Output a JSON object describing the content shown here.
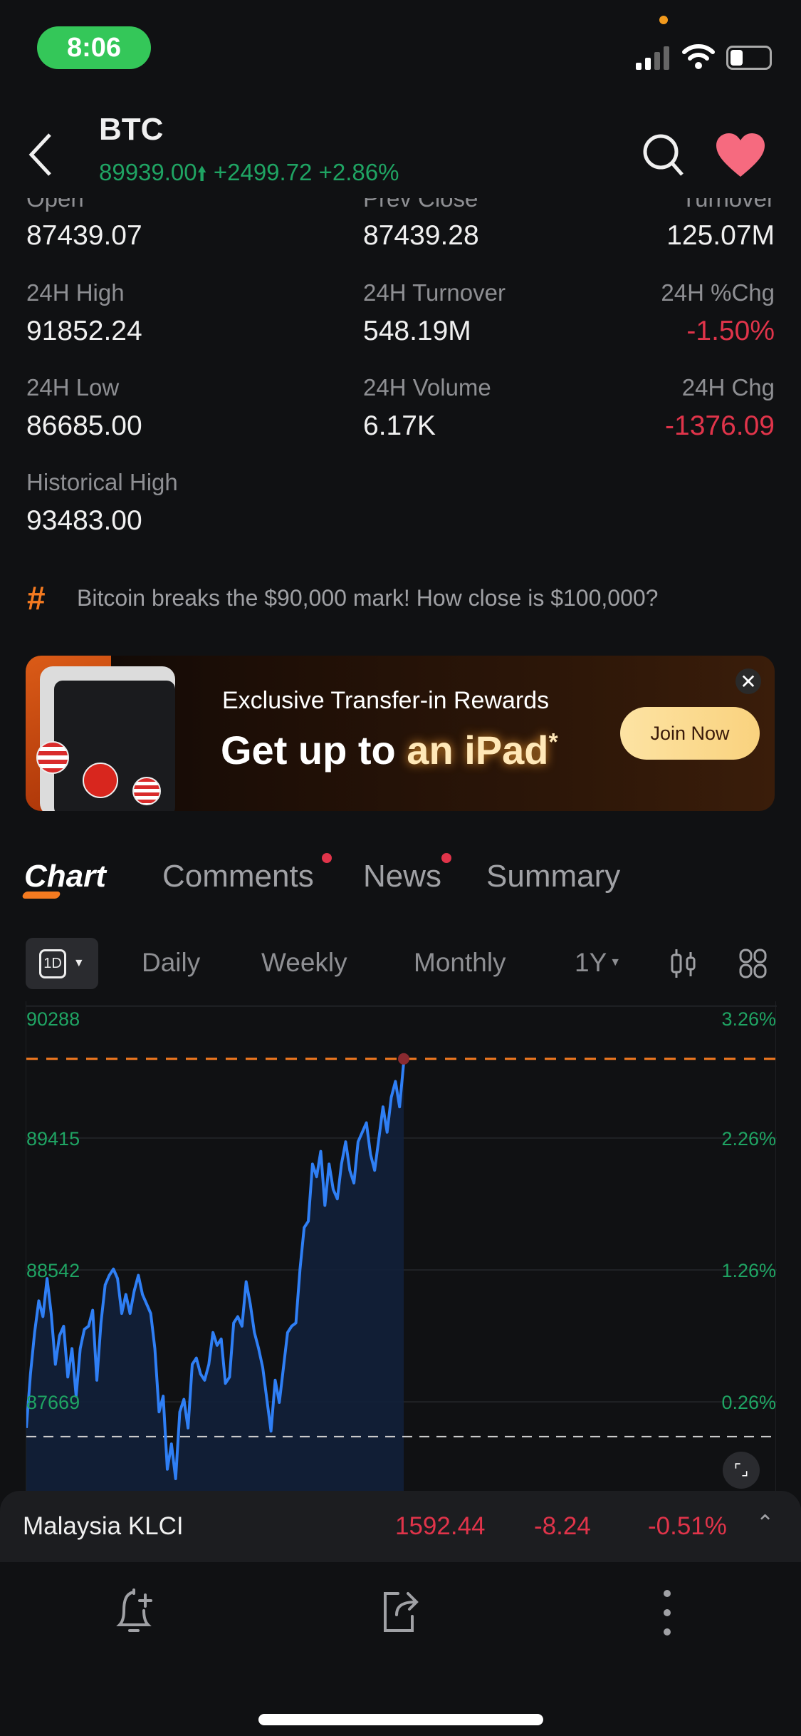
{
  "status_bar": {
    "time": "8:06"
  },
  "header": {
    "symbol": "BTC",
    "price": "89939.00",
    "change": "+2499.72",
    "change_pct": "+2.86%"
  },
  "stats": {
    "rows": [
      [
        {
          "label": "Open",
          "value": "87439.07"
        },
        {
          "label": "Prev Close",
          "value": "87439.28"
        },
        {
          "label": "Turnover",
          "value": "125.07M"
        }
      ],
      [
        {
          "label": "24H High",
          "value": "91852.24"
        },
        {
          "label": "24H Turnover",
          "value": "548.19M"
        },
        {
          "label": "24H %Chg",
          "value": "-1.50%",
          "color": "#e0344a"
        }
      ],
      [
        {
          "label": "24H Low",
          "value": "86685.00"
        },
        {
          "label": "24H Volume",
          "value": "6.17K"
        },
        {
          "label": "24H Chg",
          "value": "-1376.09",
          "color": "#e0344a"
        }
      ],
      [
        {
          "label": "Historical High",
          "value": "93483.00"
        }
      ]
    ]
  },
  "topic": {
    "text": "Bitcoin breaks the $90,000 mark! How close is $100,000?"
  },
  "banner": {
    "subtitle": "Exclusive Transfer-in Rewards",
    "title_white": "Get up to ",
    "title_gold": "an iPad",
    "asterisk": "*",
    "button": "Join Now"
  },
  "tabs": [
    {
      "label": "Chart",
      "active": true
    },
    {
      "label": "Comments",
      "dot": true
    },
    {
      "label": "News",
      "dot": true
    },
    {
      "label": "Summary"
    }
  ],
  "toolbar": {
    "interval": "1D",
    "daily": "Daily",
    "weekly": "Weekly",
    "monthly": "Monthly",
    "range": "1Y"
  },
  "colors": {
    "up": "#1fa463",
    "down": "#e0344a",
    "line": "#2f7ff5",
    "accent": "#f47a20"
  },
  "chart_data": {
    "type": "area",
    "y_ticks": [
      "90288",
      "89415",
      "88542",
      "87669"
    ],
    "y_ticks_pct": [
      "3.26%",
      "2.26%",
      "1.26%",
      "0.26%"
    ],
    "ylim": [
      87080,
      90320
    ],
    "current_price": 89939.0,
    "prev_close": 87439.28,
    "values": [
      87496,
      87854,
      88128,
      88338,
      88233,
      88485,
      88254,
      87917,
      88107,
      88170,
      87833,
      88022,
      87707,
      88022,
      88149,
      88170,
      88275,
      87812,
      88191,
      88443,
      88506,
      88548,
      88485,
      88254,
      88380,
      88254,
      88401,
      88506,
      88380,
      88317,
      88254,
      88022,
      87602,
      87707,
      87223,
      87391,
      87160,
      87602,
      87686,
      87496,
      87917,
      87959,
      87854,
      87812,
      87917,
      88128,
      88043,
      88085,
      87791,
      87833,
      88191,
      88233,
      88170,
      88464,
      88317,
      88128,
      88022,
      87896,
      87686,
      87475,
      87812,
      87665,
      87896,
      88128,
      88170,
      88191,
      88548,
      88822,
      88864,
      89243,
      89159,
      89327,
      88969,
      89243,
      89075,
      89012,
      89243,
      89390,
      89201,
      89117,
      89390,
      89453,
      89516,
      89306,
      89201,
      89411,
      89621,
      89453,
      89684,
      89790,
      89621,
      89916
    ]
  },
  "ticker": {
    "name": "Malaysia KLCI",
    "price": "1592.44",
    "change": "-8.24",
    "change_pct": "-0.51%"
  }
}
